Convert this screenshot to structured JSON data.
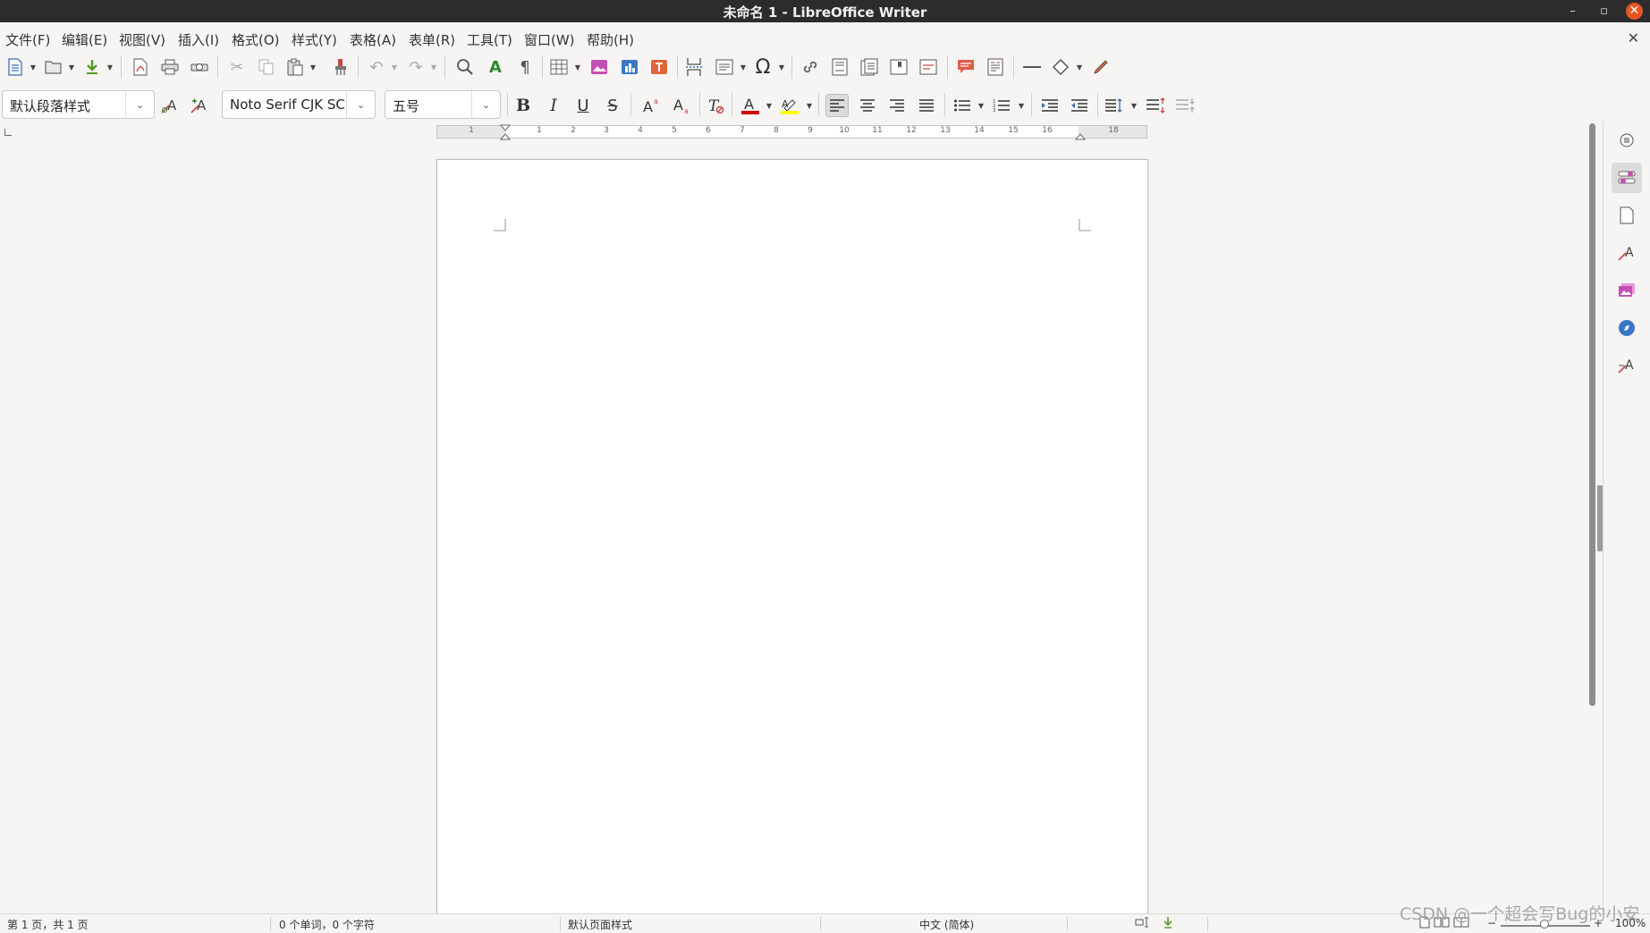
{
  "window": {
    "title": "未命名 1 - LibreOffice Writer",
    "minimize_glyph": "–",
    "restore_glyph": "▫",
    "close_glyph": "✕",
    "accent_color": "#e95420"
  },
  "menubar": {
    "items": [
      "文件(F)",
      "编辑(E)",
      "视图(V)",
      "插入(I)",
      "格式(O)",
      "样式(Y)",
      "表格(A)",
      "表单(R)",
      "工具(T)",
      "窗口(W)",
      "帮助(H)"
    ],
    "close_document_glyph": "✕"
  },
  "standard_toolbar": {
    "icons": [
      "new-document-icon",
      "open-icon",
      "save-icon",
      "export-pdf-icon",
      "print-icon",
      "print-preview-icon",
      "cut-icon",
      "copy-icon",
      "paste-icon",
      "clone-formatting-icon",
      "undo-icon",
      "redo-icon",
      "find-replace-icon",
      "spelling-icon",
      "formatting-marks-icon",
      "insert-table-icon",
      "insert-image-icon",
      "insert-chart-icon",
      "insert-text-box-icon",
      "page-break-icon",
      "insert-field-icon",
      "special-character-icon",
      "hyperlink-icon",
      "footnote-icon",
      "endnote-icon",
      "bookmark-icon",
      "cross-reference-icon",
      "comment-icon",
      "track-changes-icon",
      "line-icon",
      "basic-shapes-icon",
      "draw-icon"
    ]
  },
  "formatting_toolbar": {
    "paragraph_style": "默认段落样式",
    "font_name": "Noto Serif CJK SC",
    "font_size": "五号",
    "font_color": "#cc0000",
    "highlight_color": "#ffff00"
  },
  "ruler": {
    "labels": [
      "1",
      "1",
      "2",
      "3",
      "4",
      "5",
      "6",
      "7",
      "8",
      "9",
      "10",
      "11",
      "12",
      "13",
      "14",
      "15",
      "16",
      "18"
    ]
  },
  "statusbar": {
    "page_info": "第 1 页，共 1 页",
    "word_count": "0 个单词，0 个字符",
    "page_style": "默认页面样式",
    "language": "中文 (简体)",
    "zoom": "100%",
    "zoom_minus": "−",
    "zoom_plus": "+"
  },
  "watermark": {
    "text": "CSDN @一个超会写Bug的小安"
  }
}
